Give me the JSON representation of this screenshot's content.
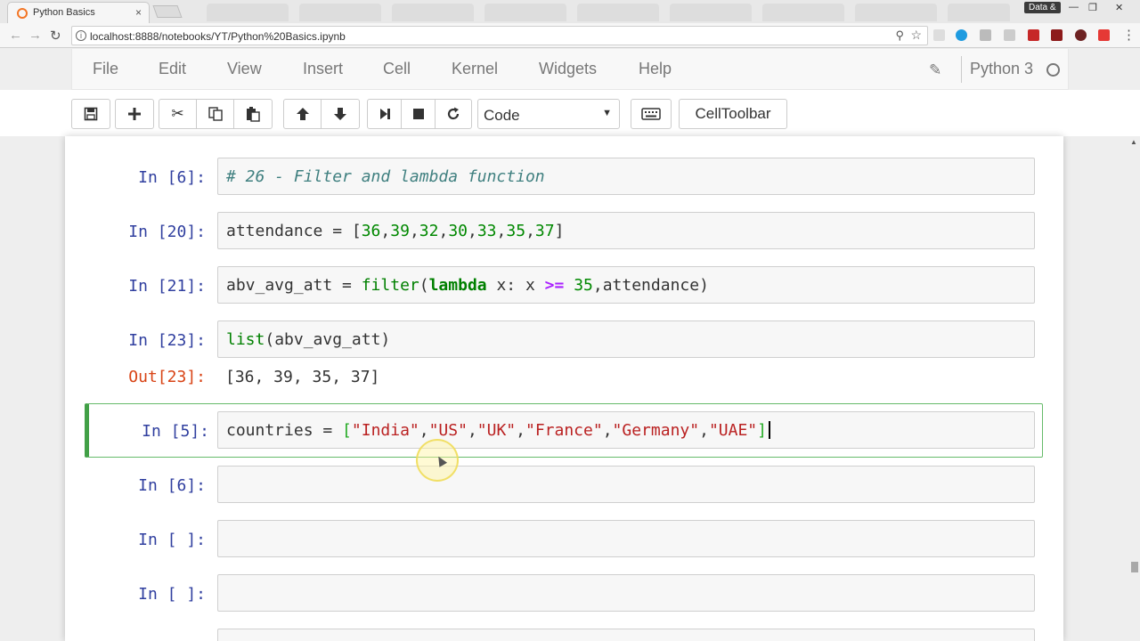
{
  "browser": {
    "tab_title": "Python Basics",
    "tab_close": "×",
    "url": "localhost:8888/notebooks/YT/Python%20Basics.ipynb",
    "window_label": "Data &",
    "back": "←",
    "forward": "→",
    "reload": "↻"
  },
  "menubar": {
    "items": [
      "File",
      "Edit",
      "View",
      "Insert",
      "Cell",
      "Kernel",
      "Widgets",
      "Help"
    ],
    "kernel_name": "Python 3"
  },
  "toolbar": {
    "cell_type": "Code",
    "celltoolbar_label": "CellToolbar",
    "buttons": [
      "save-icon",
      "plus-icon",
      "cut-icon",
      "copy-icon",
      "paste-icon",
      "arrow-up-icon",
      "arrow-down-icon",
      "step-forward-icon",
      "stop-icon",
      "refresh-icon"
    ]
  },
  "cells": [
    {
      "prompt": "In [6]:",
      "code": "# 26 - Filter and lambda function"
    },
    {
      "prompt": "In [20]:",
      "code": "attendance = [36,39,32,30,33,35,37]"
    },
    {
      "prompt": "In [21]:",
      "code": "abv_avg_att = filter(lambda x: x >= 35,attendance)"
    },
    {
      "prompt": "In [23]:",
      "code": "list(abv_avg_att)",
      "out_prompt": "Out[23]:",
      "output": "[36, 39, 35, 37]"
    },
    {
      "prompt": "In [5]:",
      "code": "countries = [\"India\",\"US\",\"UK\",\"France\",\"Germany\",\"UAE\"]"
    },
    {
      "prompt": "In [6]:",
      "code": ""
    },
    {
      "prompt": "In [ ]:",
      "code": ""
    },
    {
      "prompt": "In [ ]:",
      "code": ""
    }
  ],
  "colors": {
    "prompt_in": "#303f9f",
    "prompt_out": "#d84315",
    "selected_border": "#42a047"
  }
}
